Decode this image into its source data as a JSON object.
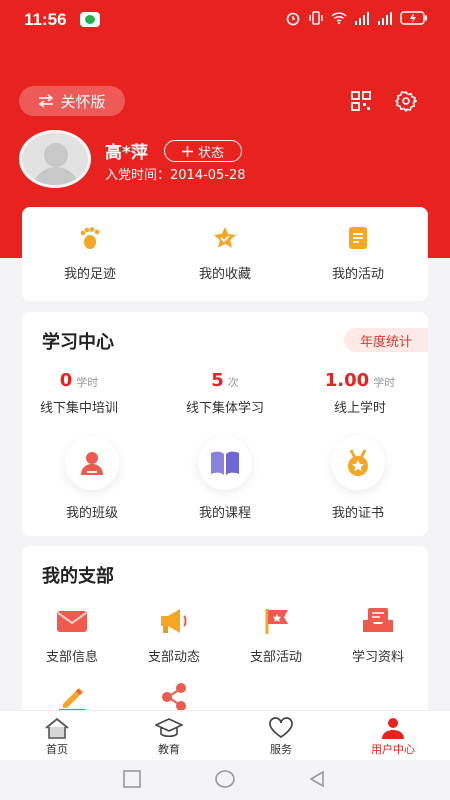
{
  "status_bar": {
    "time": "11:56"
  },
  "header": {
    "mode_button_label": "关怀版"
  },
  "profile": {
    "name": "高*萍",
    "status_button_label": "状态",
    "join_date": "入党时间：2014-05-28"
  },
  "quick_links": [
    {
      "label": "我的足迹",
      "icon": "footprint-icon"
    },
    {
      "label": "我的收藏",
      "icon": "star-icon"
    },
    {
      "label": "我的活动",
      "icon": "document-icon"
    }
  ],
  "study_center": {
    "title": "学习中心",
    "year_tag": "年度统计",
    "stats": [
      {
        "value": "0",
        "unit": "学时",
        "label": "线下集中培训"
      },
      {
        "value": "5",
        "unit": "次",
        "label": "线下集体学习"
      },
      {
        "value": "1.00",
        "unit": "学时",
        "label": "线上学时"
      }
    ],
    "links": [
      {
        "label": "我的班级",
        "icon": "person-icon"
      },
      {
        "label": "我的课程",
        "icon": "book-icon"
      },
      {
        "label": "我的证书",
        "icon": "medal-icon"
      }
    ]
  },
  "branch": {
    "title": "我的支部",
    "items": [
      {
        "label": "支部信息",
        "icon": "mail-icon"
      },
      {
        "label": "支部动态",
        "icon": "megaphone-icon"
      },
      {
        "label": "支部活动",
        "icon": "flag-icon"
      },
      {
        "label": "学习资料",
        "icon": "inbox-icon"
      },
      {
        "label": "",
        "icon": "pencil-icon"
      },
      {
        "label": "",
        "icon": "share-icon"
      }
    ]
  },
  "bottom_nav": [
    {
      "label": "首页",
      "icon": "home-icon"
    },
    {
      "label": "教育",
      "icon": "graduation-cap-icon"
    },
    {
      "label": "服务",
      "icon": "heart-icon"
    },
    {
      "label": "用户中心",
      "icon": "user-icon",
      "active": true
    }
  ],
  "colors": {
    "brand_red": "#e8231f",
    "accent_orange": "#f5a623"
  }
}
